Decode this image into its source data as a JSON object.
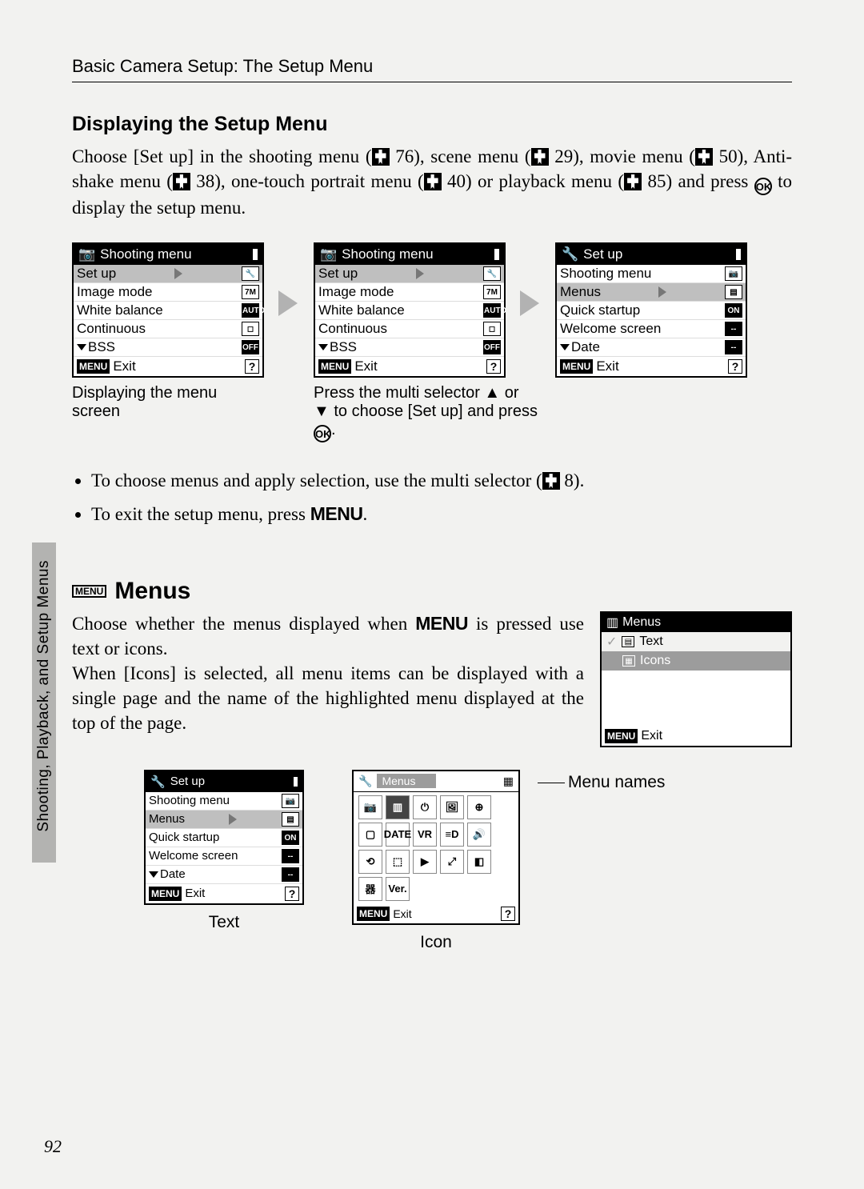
{
  "header": "Basic Camera Setup: The Setup Menu",
  "section1_title": "Displaying the Setup Menu",
  "intro_p1a": "Choose [Set up] in the shooting menu (",
  "intro_ref1": " 76), scene menu (",
  "intro_ref2": " 29), movie menu (",
  "intro_ref3": " 50), Anti-shake menu (",
  "intro_ref4": " 38), one-touch portrait menu (",
  "intro_ref5": " 40) or playback menu (",
  "intro_ref6": " 85) and press ",
  "intro_p1b": " to display the setup menu.",
  "ok_label": "OK",
  "screens": {
    "shooting": {
      "title": "Shooting menu",
      "rows": [
        {
          "label": "Set up",
          "ind": "",
          "sel": true
        },
        {
          "label": "Image mode",
          "ind": "7M"
        },
        {
          "label": "White balance",
          "ind": "AUTO",
          "dark": true
        },
        {
          "label": "Continuous",
          "ind": "◻"
        },
        {
          "label": "BSS",
          "ind": "OFF",
          "dark": true,
          "caret": true
        }
      ],
      "footer": "Exit"
    },
    "shooting2": {
      "title": "Shooting menu",
      "rows": [
        {
          "label": "Set up",
          "ind": "",
          "sel": true
        },
        {
          "label": "Image mode",
          "ind": "7M"
        },
        {
          "label": "White balance",
          "ind": "AUTO",
          "dark": true
        },
        {
          "label": "Continuous",
          "ind": "◻"
        },
        {
          "label": "BSS",
          "ind": "OFF",
          "dark": true,
          "caret": true
        }
      ],
      "footer": "Exit"
    },
    "setup": {
      "title": "Set up",
      "rows": [
        {
          "label": "Shooting menu",
          "ind": "📷"
        },
        {
          "label": "Menus",
          "ind": "▤",
          "sel": true
        },
        {
          "label": "Quick startup",
          "ind": "ON",
          "dark": true
        },
        {
          "label": "Welcome screen",
          "ind": "--",
          "dark": true
        },
        {
          "label": "Date",
          "ind": "--",
          "dark": true,
          "caret": true
        }
      ],
      "footer": "Exit"
    }
  },
  "caption1": "Displaying the menu screen",
  "caption2": "Press the multi selector ▲ or ▼ to choose [Set up] and press ",
  "bullets": {
    "b1a": "To choose menus and apply selection, use the multi selector (",
    "b1b": " 8).",
    "b2a": "To exit the setup menu, press ",
    "b2b": "."
  },
  "menu_word": "MENU",
  "menus_heading": "Menus",
  "menus_heading_icon": "MENU",
  "menus_p1a": "Choose whether the menus displayed when ",
  "menus_p1b": " is pressed use text or icons.",
  "menus_p2": "When [Icons] is selected, all menu items can be displayed with a single page and the name of the highlighted menu displayed at the top of the page.",
  "menus_lcd": {
    "title": "Menus",
    "opt1": "Text",
    "opt2": "Icons",
    "footer": "Exit"
  },
  "lower": {
    "setup_title": "Set up",
    "setup_rows": [
      {
        "label": "Shooting menu",
        "ind": "📷"
      },
      {
        "label": "Menus",
        "ind": "▤",
        "sel": true
      },
      {
        "label": "Quick startup",
        "ind": "ON",
        "dark": true
      },
      {
        "label": "Welcome screen",
        "ind": "--",
        "dark": true
      },
      {
        "label": "Date",
        "ind": "--",
        "dark": true,
        "caret": true
      }
    ],
    "setup_footer": "Exit",
    "text_caption": "Text",
    "icon_title": "Menus",
    "icon_cells": [
      "📷",
      "▥",
      "⏻",
      "🖼",
      "⊕",
      "▢",
      "DATE",
      "VR",
      "≡D",
      "🔊",
      "⟲",
      "⬚",
      "▶",
      "⤢",
      "◧",
      "器",
      "Ver.",
      "",
      "",
      ""
    ],
    "icon_footer": "Exit",
    "icon_caption": "Icon",
    "menu_names": "Menu names"
  },
  "side_tab": "Shooting, Playback, and Setup Menus",
  "page_number": "92"
}
